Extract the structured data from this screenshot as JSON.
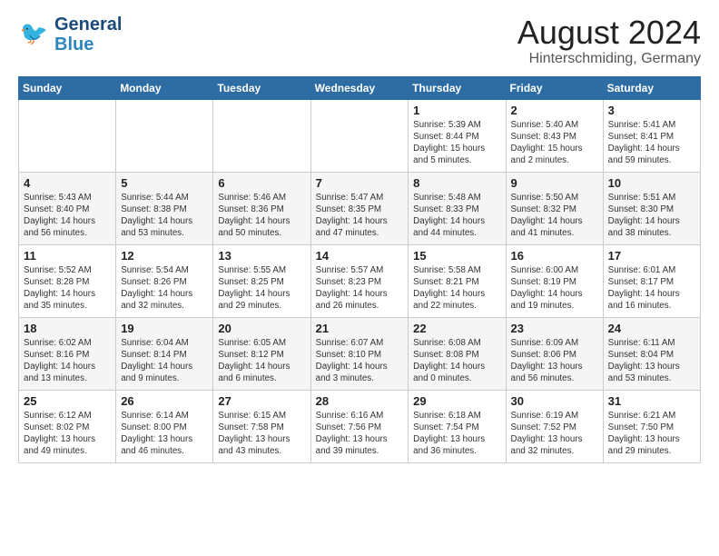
{
  "header": {
    "logo_line1": "General",
    "logo_line2": "Blue",
    "title": "August 2024",
    "subtitle": "Hinterschmiding, Germany"
  },
  "weekdays": [
    "Sunday",
    "Monday",
    "Tuesday",
    "Wednesday",
    "Thursday",
    "Friday",
    "Saturday"
  ],
  "weeks": [
    [
      {
        "day": "",
        "sunrise": "",
        "sunset": "",
        "daylight": ""
      },
      {
        "day": "",
        "sunrise": "",
        "sunset": "",
        "daylight": ""
      },
      {
        "day": "",
        "sunrise": "",
        "sunset": "",
        "daylight": ""
      },
      {
        "day": "",
        "sunrise": "",
        "sunset": "",
        "daylight": ""
      },
      {
        "day": "1",
        "sunrise": "Sunrise: 5:39 AM",
        "sunset": "Sunset: 8:44 PM",
        "daylight": "Daylight: 15 hours and 5 minutes."
      },
      {
        "day": "2",
        "sunrise": "Sunrise: 5:40 AM",
        "sunset": "Sunset: 8:43 PM",
        "daylight": "Daylight: 15 hours and 2 minutes."
      },
      {
        "day": "3",
        "sunrise": "Sunrise: 5:41 AM",
        "sunset": "Sunset: 8:41 PM",
        "daylight": "Daylight: 14 hours and 59 minutes."
      }
    ],
    [
      {
        "day": "4",
        "sunrise": "Sunrise: 5:43 AM",
        "sunset": "Sunset: 8:40 PM",
        "daylight": "Daylight: 14 hours and 56 minutes."
      },
      {
        "day": "5",
        "sunrise": "Sunrise: 5:44 AM",
        "sunset": "Sunset: 8:38 PM",
        "daylight": "Daylight: 14 hours and 53 minutes."
      },
      {
        "day": "6",
        "sunrise": "Sunrise: 5:46 AM",
        "sunset": "Sunset: 8:36 PM",
        "daylight": "Daylight: 14 hours and 50 minutes."
      },
      {
        "day": "7",
        "sunrise": "Sunrise: 5:47 AM",
        "sunset": "Sunset: 8:35 PM",
        "daylight": "Daylight: 14 hours and 47 minutes."
      },
      {
        "day": "8",
        "sunrise": "Sunrise: 5:48 AM",
        "sunset": "Sunset: 8:33 PM",
        "daylight": "Daylight: 14 hours and 44 minutes."
      },
      {
        "day": "9",
        "sunrise": "Sunrise: 5:50 AM",
        "sunset": "Sunset: 8:32 PM",
        "daylight": "Daylight: 14 hours and 41 minutes."
      },
      {
        "day": "10",
        "sunrise": "Sunrise: 5:51 AM",
        "sunset": "Sunset: 8:30 PM",
        "daylight": "Daylight: 14 hours and 38 minutes."
      }
    ],
    [
      {
        "day": "11",
        "sunrise": "Sunrise: 5:52 AM",
        "sunset": "Sunset: 8:28 PM",
        "daylight": "Daylight: 14 hours and 35 minutes."
      },
      {
        "day": "12",
        "sunrise": "Sunrise: 5:54 AM",
        "sunset": "Sunset: 8:26 PM",
        "daylight": "Daylight: 14 hours and 32 minutes."
      },
      {
        "day": "13",
        "sunrise": "Sunrise: 5:55 AM",
        "sunset": "Sunset: 8:25 PM",
        "daylight": "Daylight: 14 hours and 29 minutes."
      },
      {
        "day": "14",
        "sunrise": "Sunrise: 5:57 AM",
        "sunset": "Sunset: 8:23 PM",
        "daylight": "Daylight: 14 hours and 26 minutes."
      },
      {
        "day": "15",
        "sunrise": "Sunrise: 5:58 AM",
        "sunset": "Sunset: 8:21 PM",
        "daylight": "Daylight: 14 hours and 22 minutes."
      },
      {
        "day": "16",
        "sunrise": "Sunrise: 6:00 AM",
        "sunset": "Sunset: 8:19 PM",
        "daylight": "Daylight: 14 hours and 19 minutes."
      },
      {
        "day": "17",
        "sunrise": "Sunrise: 6:01 AM",
        "sunset": "Sunset: 8:17 PM",
        "daylight": "Daylight: 14 hours and 16 minutes."
      }
    ],
    [
      {
        "day": "18",
        "sunrise": "Sunrise: 6:02 AM",
        "sunset": "Sunset: 8:16 PM",
        "daylight": "Daylight: 14 hours and 13 minutes."
      },
      {
        "day": "19",
        "sunrise": "Sunrise: 6:04 AM",
        "sunset": "Sunset: 8:14 PM",
        "daylight": "Daylight: 14 hours and 9 minutes."
      },
      {
        "day": "20",
        "sunrise": "Sunrise: 6:05 AM",
        "sunset": "Sunset: 8:12 PM",
        "daylight": "Daylight: 14 hours and 6 minutes."
      },
      {
        "day": "21",
        "sunrise": "Sunrise: 6:07 AM",
        "sunset": "Sunset: 8:10 PM",
        "daylight": "Daylight: 14 hours and 3 minutes."
      },
      {
        "day": "22",
        "sunrise": "Sunrise: 6:08 AM",
        "sunset": "Sunset: 8:08 PM",
        "daylight": "Daylight: 14 hours and 0 minutes."
      },
      {
        "day": "23",
        "sunrise": "Sunrise: 6:09 AM",
        "sunset": "Sunset: 8:06 PM",
        "daylight": "Daylight: 13 hours and 56 minutes."
      },
      {
        "day": "24",
        "sunrise": "Sunrise: 6:11 AM",
        "sunset": "Sunset: 8:04 PM",
        "daylight": "Daylight: 13 hours and 53 minutes."
      }
    ],
    [
      {
        "day": "25",
        "sunrise": "Sunrise: 6:12 AM",
        "sunset": "Sunset: 8:02 PM",
        "daylight": "Daylight: 13 hours and 49 minutes."
      },
      {
        "day": "26",
        "sunrise": "Sunrise: 6:14 AM",
        "sunset": "Sunset: 8:00 PM",
        "daylight": "Daylight: 13 hours and 46 minutes."
      },
      {
        "day": "27",
        "sunrise": "Sunrise: 6:15 AM",
        "sunset": "Sunset: 7:58 PM",
        "daylight": "Daylight: 13 hours and 43 minutes."
      },
      {
        "day": "28",
        "sunrise": "Sunrise: 6:16 AM",
        "sunset": "Sunset: 7:56 PM",
        "daylight": "Daylight: 13 hours and 39 minutes."
      },
      {
        "day": "29",
        "sunrise": "Sunrise: 6:18 AM",
        "sunset": "Sunset: 7:54 PM",
        "daylight": "Daylight: 13 hours and 36 minutes."
      },
      {
        "day": "30",
        "sunrise": "Sunrise: 6:19 AM",
        "sunset": "Sunset: 7:52 PM",
        "daylight": "Daylight: 13 hours and 32 minutes."
      },
      {
        "day": "31",
        "sunrise": "Sunrise: 6:21 AM",
        "sunset": "Sunset: 7:50 PM",
        "daylight": "Daylight: 13 hours and 29 minutes."
      }
    ]
  ]
}
